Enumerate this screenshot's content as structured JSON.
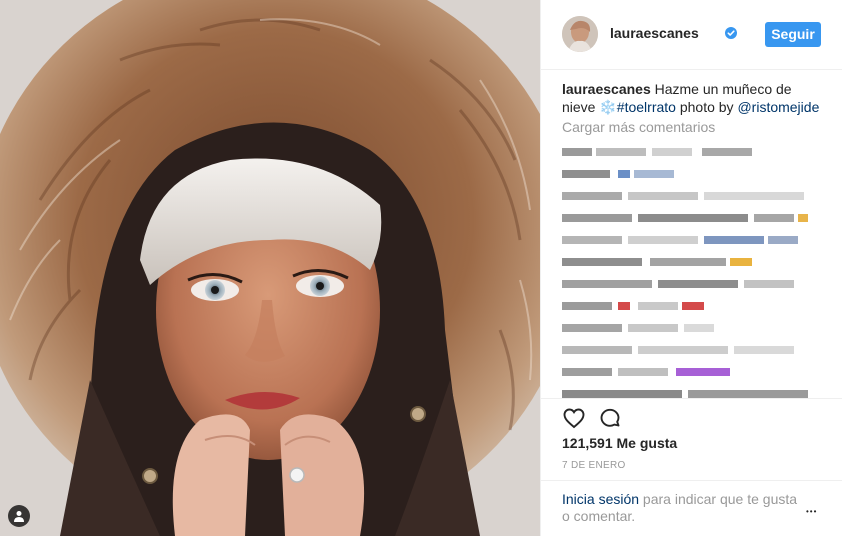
{
  "post": {
    "username": "lauraescanes",
    "follow_label": "Seguir",
    "caption_text": " Hazme un muñeco de nieve ",
    "snowflake": "❄️",
    "hashtag": "#toelrrato",
    "photo_by": " photo by ",
    "mention": "@ristomejide",
    "load_more": "Cargar más comentarios",
    "likes": "121,591 Me gusta",
    "date": "7 DE ENERO",
    "login_link": "Inicia sesión",
    "login_rest": " para indicar que te gusta o comentar.",
    "more_glyph": "•••"
  },
  "colors": {
    "accent": "#3897f0",
    "link": "#003569",
    "muted": "#999999"
  }
}
